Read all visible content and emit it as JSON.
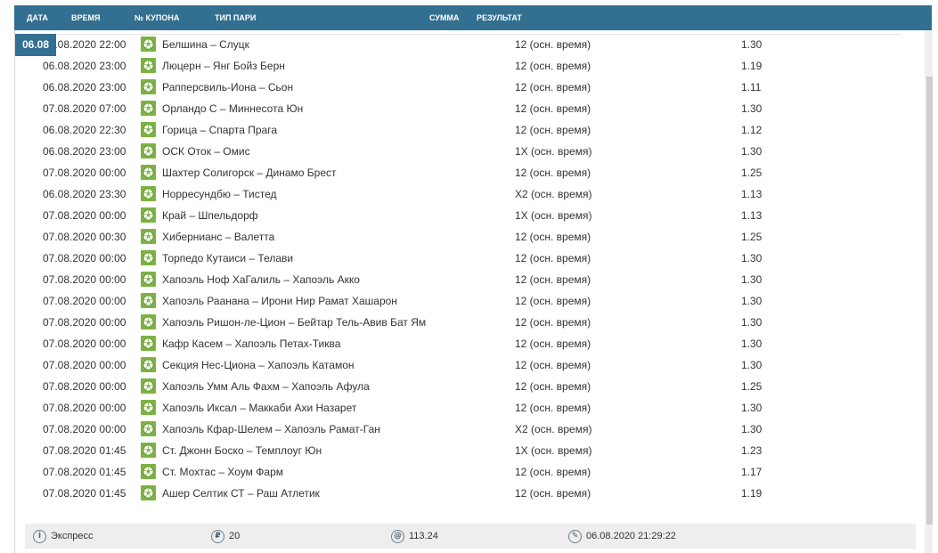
{
  "header": {
    "col_date": "ДАТА",
    "col_time": "ВРЕМЯ",
    "col_coupon": "№ КУПОНА",
    "col_bet_type": "ТИП ПАРИ",
    "col_sum": "СУММА",
    "col_result": "РЕЗУЛЬТАТ"
  },
  "date_badge": "06.08",
  "accent_color": "#326f91",
  "sport_icon": "soccer-ball-icon",
  "sport_icon_color": "#7cb342",
  "rows": [
    {
      "time": "06.08.2020 22:00",
      "match": "Белшина – Слуцк",
      "bet": "12 (осн. время)",
      "odds": "1.30"
    },
    {
      "time": "06.08.2020 23:00",
      "match": "Люцерн – Янг Бойз Берн",
      "bet": "12 (осн. время)",
      "odds": "1.19"
    },
    {
      "time": "06.08.2020 23:00",
      "match": "Рапперсвиль-Иона – Сьон",
      "bet": "12 (осн. время)",
      "odds": "1.11"
    },
    {
      "time": "07.08.2020 07:00",
      "match": "Орландо С – Миннесота Юн",
      "bet": "12 (осн. время)",
      "odds": "1.30"
    },
    {
      "time": "06.08.2020 22:30",
      "match": "Горица – Спарта Прага",
      "bet": "12 (осн. время)",
      "odds": "1.12"
    },
    {
      "time": "06.08.2020 23:00",
      "match": "ОСК Оток – Омис",
      "bet": "1Х (осн. время)",
      "odds": "1.30"
    },
    {
      "time": "07.08.2020 00:00",
      "match": "Шахтер Солигорск – Динамо Брест",
      "bet": "12 (осн. время)",
      "odds": "1.25"
    },
    {
      "time": "06.08.2020 23:30",
      "match": "Норресундбю – Тистед",
      "bet": "Х2 (осн. время)",
      "odds": "1.13"
    },
    {
      "time": "07.08.2020 00:00",
      "match": "Край – Шпельдорф",
      "bet": "1Х (осн. время)",
      "odds": "1.13"
    },
    {
      "time": "07.08.2020 00:30",
      "match": "Хибернианс – Валетта",
      "bet": "12 (осн. время)",
      "odds": "1.25"
    },
    {
      "time": "07.08.2020 00:00",
      "match": "Торпедо Кутаиси – Телави",
      "bet": "12 (осн. время)",
      "odds": "1.30"
    },
    {
      "time": "07.08.2020 00:00",
      "match": "Хапоэль Ноф ХаГалиль – Хапоэль Акко",
      "bet": "12 (осн. время)",
      "odds": "1.30"
    },
    {
      "time": "07.08.2020 00:00",
      "match": "Хапоэль Раанана – Ирони Нир Рамат Хашарон",
      "bet": "12 (осн. время)",
      "odds": "1.30"
    },
    {
      "time": "07.08.2020 00:00",
      "match": "Хапоэль Ришон-ле-Цион – Бейтар Тель-Авив Бат Ям",
      "bet": "12 (осн. время)",
      "odds": "1.30"
    },
    {
      "time": "07.08.2020 00:00",
      "match": "Кафр Касем – Хапоэль Петах-Тиква",
      "bet": "12 (осн. время)",
      "odds": "1.30"
    },
    {
      "time": "07.08.2020 00:00",
      "match": "Секция Нес-Циона – Хапоэль Катамон",
      "bet": "12 (осн. время)",
      "odds": "1.30"
    },
    {
      "time": "07.08.2020 00:00",
      "match": "Хапоэль Умм Аль Фахм – Хапоэль Афула",
      "bet": "12 (осн. время)",
      "odds": "1.25"
    },
    {
      "time": "07.08.2020 00:00",
      "match": "Хапоэль Иксал – Маккаби Ахи Назарет",
      "bet": "12 (осн. время)",
      "odds": "1.30"
    },
    {
      "time": "07.08.2020 00:00",
      "match": "Хапоэль Кфар-Шелем – Хапоэль Рамат-Ган",
      "bet": "Х2 (осн. время)",
      "odds": "1.30"
    },
    {
      "time": "07.08.2020 01:45",
      "match": "Ст. Джонн Боско – Темплоуг Юн",
      "bet": "1Х (осн. время)",
      "odds": "1.23"
    },
    {
      "time": "07.08.2020 01:45",
      "match": "Ст. Мохтас – Хоум Фарм",
      "bet": "12 (осн. время)",
      "odds": "1.17"
    },
    {
      "time": "07.08.2020 01:45",
      "match": "Ашер Селтик СТ – Раш Атлетик",
      "bet": "12 (осн. время)",
      "odds": "1.19"
    }
  ],
  "footer": {
    "type_icon": "info-icon",
    "type_icon_glyph": "i",
    "type_label": "Экспресс",
    "stake_icon": "ruble-icon",
    "stake_icon_glyph": "₽",
    "stake": "20",
    "total_icon": "at-icon",
    "total_icon_glyph": "@",
    "total_odds": "113.24",
    "date_icon": "pen-icon",
    "date_icon_glyph": "✎",
    "placed_at": "06.08.2020 21:29:22"
  }
}
